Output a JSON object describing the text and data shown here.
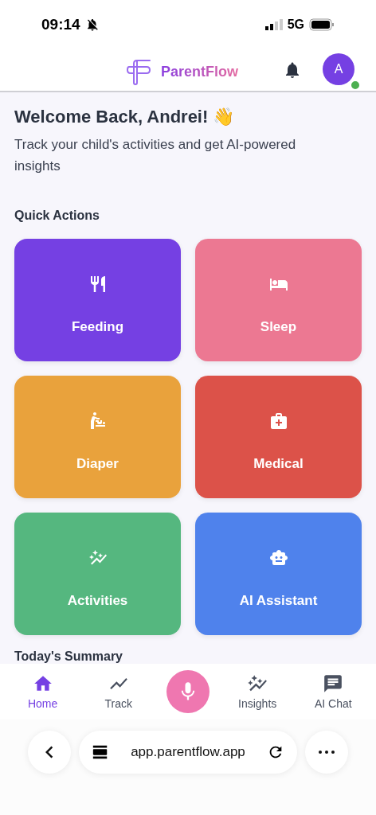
{
  "status_bar": {
    "time": "09:14",
    "network": "5G"
  },
  "header": {
    "brand": "ParentFlow",
    "avatar": "A",
    "online": true
  },
  "welcome": {
    "title": "Welcome Back, Andrei! 👋",
    "subtitle": "Track your child's activities and get AI-powered insights"
  },
  "quick_actions": {
    "title": "Quick Actions",
    "items": [
      {
        "label": "Feeding",
        "kind": "feeding",
        "color": "#7540e3"
      },
      {
        "label": "Sleep",
        "kind": "sleep",
        "color": "#ec7892"
      },
      {
        "label": "Diaper",
        "kind": "diaper",
        "color": "#e9a23c"
      },
      {
        "label": "Medical",
        "kind": "medical",
        "color": "#dc5249"
      },
      {
        "label": "Activities",
        "kind": "activities",
        "color": "#55b77f"
      },
      {
        "label": "AI Assistant",
        "kind": "assistant",
        "color": "#4f82ec"
      }
    ]
  },
  "summary": {
    "title": "Today's Summary"
  },
  "bottom_nav": [
    {
      "label": "Home",
      "kind": "home",
      "selected": true
    },
    {
      "label": "Track",
      "kind": "track",
      "selected": false
    },
    {
      "kind": "voice",
      "selected": false
    },
    {
      "label": "Insights",
      "kind": "insights",
      "selected": false
    },
    {
      "label": "AI Chat",
      "kind": "chat",
      "selected": false
    }
  ],
  "browser": {
    "url": "app.parentflow.app"
  }
}
